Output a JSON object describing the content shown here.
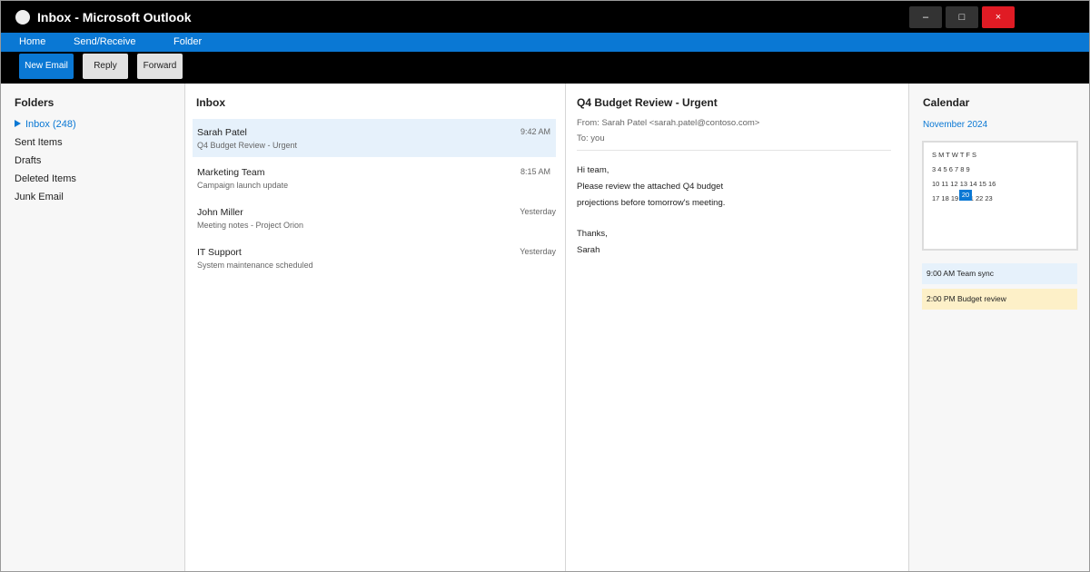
{
  "window": {
    "title": "Inbox - Microsoft Outlook",
    "controls": {
      "minimize": "–",
      "maximize": "□",
      "close": "×"
    }
  },
  "menu": [
    "Home",
    "Send/Receive",
    "Folder"
  ],
  "ribbon": {
    "new_email": "New Email",
    "reply": "Reply",
    "forward": "Forward"
  },
  "folders": {
    "title": "Folders",
    "items": [
      {
        "label": "Inbox (248)",
        "active": true
      },
      {
        "label": "Sent Items"
      },
      {
        "label": "Drafts"
      },
      {
        "label": "Deleted Items"
      },
      {
        "label": "Junk Email"
      }
    ]
  },
  "inbox": {
    "title": "Inbox",
    "messages": [
      {
        "from": "Sarah Patel",
        "subject": "Q4 Budget Review - Urgent",
        "time": "9:42 AM",
        "selected": true
      },
      {
        "from": "Marketing Team",
        "subject": "Campaign launch update",
        "time": "8:15 AM"
      },
      {
        "from": "John Miller",
        "subject": "Meeting notes - Project Orion",
        "time": "Yesterday"
      },
      {
        "from": "IT Support",
        "subject": "System maintenance scheduled",
        "time": "Yesterday"
      }
    ]
  },
  "reading": {
    "subject": "Q4 Budget Review - Urgent",
    "from": "From: Sarah Patel <sarah.patel@contoso.com>",
    "to": "To: you",
    "body": [
      "Hi team,",
      "Please review the attached Q4 budget",
      "projections before tomorrow's meeting.",
      "Thanks,",
      "Sarah"
    ]
  },
  "calendar": {
    "title": "Calendar",
    "month": "November 2024",
    "weekdays": "S M T W T F S",
    "rows": [
      "3 4 5 6 7 8 9",
      "10 11 12 13 14 15 16",
      "17 18 19    21 22 23"
    ],
    "today": "20",
    "events": [
      "9:00 AM Team sync",
      "2:00 PM Budget review"
    ]
  },
  "colors": {
    "accent": "#0a78d4",
    "titlebar": "#000000",
    "close": "#e01b24",
    "selected": "#e6f1fb",
    "event_highlight": "#fdf0c8"
  }
}
